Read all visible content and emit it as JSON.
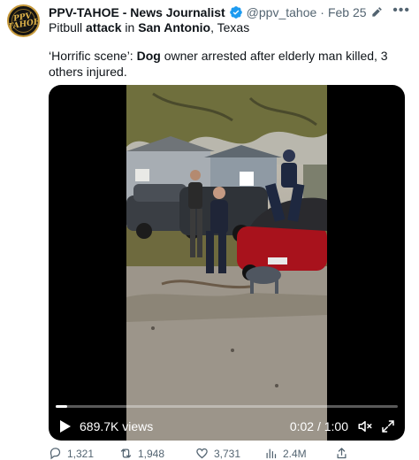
{
  "tweet": {
    "author_name": "PPV-TAHOE - News Journalist",
    "handle": "@ppv_tahoe",
    "separator": "·",
    "date": "Feb 25",
    "avatar_text_line1": "PPV",
    "avatar_text_line2": "TAHOE",
    "line1": {
      "t1": "Pitbull ",
      "t2": "attack",
      "t3": " in ",
      "t4": "San Antonio",
      "t5": ", Texas"
    },
    "para": {
      "t1": "‘Horrific scene’: ",
      "t2": "Dog",
      "t3": " owner arrested after elderly man killed, 3 others injured."
    }
  },
  "video": {
    "views": "689.7K views",
    "time": "0:02 / 1:00",
    "progress": 0.033
  },
  "actions": {
    "replies": "1,321",
    "reposts": "1,948",
    "likes": "3,731",
    "views": "2.4M"
  },
  "colors": {
    "accent": "#1d9bf0",
    "muted": "#536471",
    "car_red": "#a8121c"
  }
}
